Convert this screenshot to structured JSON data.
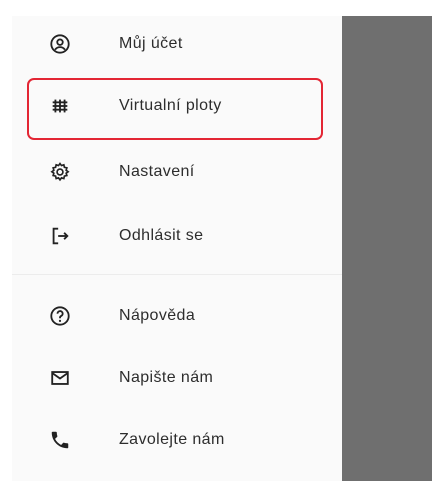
{
  "drawer": {
    "items_top": [
      {
        "icon": "account-circle-icon",
        "label": "Můj účet"
      },
      {
        "icon": "grid-fence-icon",
        "label": "Virtualní ploty",
        "highlighted": true
      },
      {
        "icon": "gear-icon",
        "label": "Nastavení"
      },
      {
        "icon": "logout-icon",
        "label": "Odhlásit se"
      }
    ],
    "items_bottom": [
      {
        "icon": "help-circle-icon",
        "label": "Nápověda"
      },
      {
        "icon": "mail-icon",
        "label": "Napište nám"
      },
      {
        "icon": "phone-icon",
        "label": "Zavolejte nám"
      }
    ]
  },
  "colors": {
    "drawer_background": "#fafafa",
    "scrim": "#6f6f6f",
    "highlight_border": "#e32634",
    "text": "#2d2d2d"
  }
}
